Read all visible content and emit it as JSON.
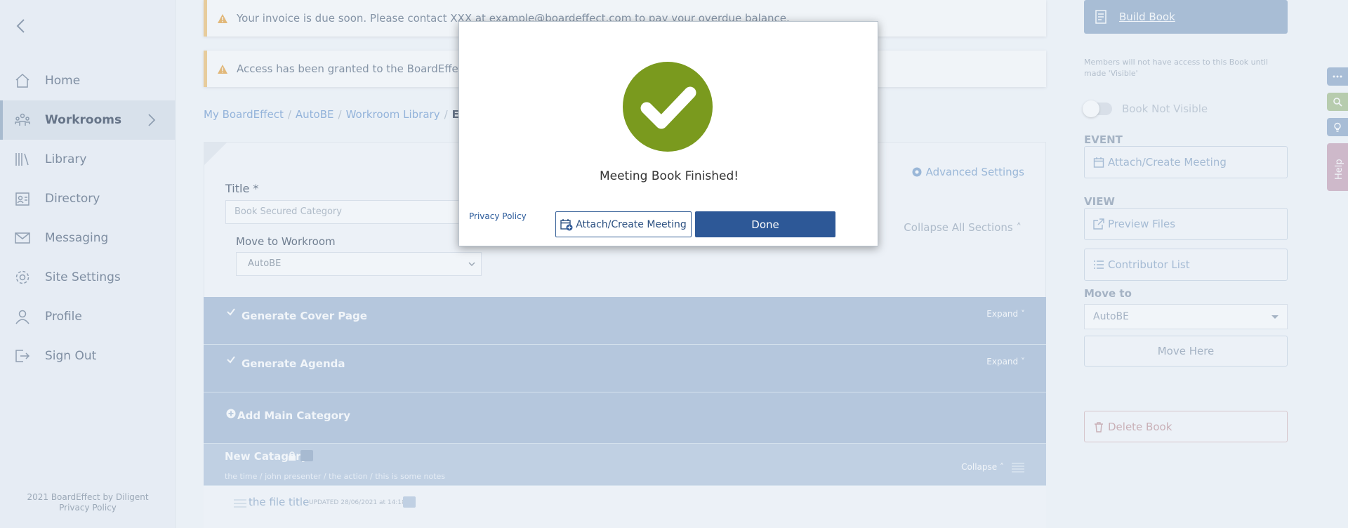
{
  "sidebar": {
    "items": [
      {
        "label": "Home",
        "icon": "home-icon"
      },
      {
        "label": "Workrooms",
        "icon": "workrooms-icon",
        "active": true
      },
      {
        "label": "Library",
        "icon": "library-icon"
      },
      {
        "label": "Directory",
        "icon": "directory-icon"
      },
      {
        "label": "Messaging",
        "icon": "mail-icon"
      },
      {
        "label": "Site Settings",
        "icon": "gear-icon"
      },
      {
        "label": "Profile",
        "icon": "user-icon"
      },
      {
        "label": "Sign Out",
        "icon": "sign-out-icon"
      }
    ],
    "footer_copyright": "2021 BoardEffect by Diligent",
    "footer_policy": "Privacy Policy"
  },
  "banners": {
    "invoice": "Your invoice is due soon. Please contact XXX at example@boardeffect.com to pay your overdue balance.",
    "access": "Access has been granted to the BoardEffect Supp"
  },
  "breadcrumbs": [
    "My BoardEffect",
    "AutoBE",
    "Workroom Library",
    "Edit B"
  ],
  "form": {
    "advanced_settings": "Advanced Settings",
    "title_label": "Title *",
    "title_value": "Book Secured Category",
    "move_label": "Move to Workroom",
    "move_value": "AutoBE",
    "collapse_all": "Collapse All Sections"
  },
  "sections": {
    "cover": {
      "title": "Generate Cover Page",
      "action": "Expand"
    },
    "agenda": {
      "title": "Generate Agenda",
      "action": "Expand"
    },
    "add_main": {
      "title": "Add Main Category"
    },
    "new_category": {
      "title": "New Catagory",
      "subtitle": "the time / john presenter / the action / this is some notes",
      "action": "Collapse"
    },
    "file": {
      "title": "the file title",
      "updated": "UPDATED 28/06/2021 at 14:18"
    }
  },
  "right_panel": {
    "build_book": "Build Book",
    "visibility_note": "Members will not have access to this Book until made 'Visible'",
    "toggle_label": "Book Not Visible",
    "event_heading": "EVENT",
    "attach_meeting": "Attach/Create Meeting",
    "view_heading": "VIEW",
    "preview_files": "Preview Files",
    "contributor_list": "Contributor List",
    "move_heading": "Move to",
    "move_value": "AutoBE",
    "move_here": "Move Here",
    "delete_book": "Delete Book"
  },
  "side_tabs": {
    "help": "Help"
  },
  "modal": {
    "message": "Meeting Book Finished!",
    "privacy_policy": "Privacy Policy",
    "attach_button": "Attach/Create Meeting",
    "done_button": "Done"
  },
  "colors": {
    "success_green": "#7a9a1e",
    "primary_blue": "#2d5897",
    "section_blue": "#a3b9d5",
    "warning_border": "#f0c070"
  }
}
